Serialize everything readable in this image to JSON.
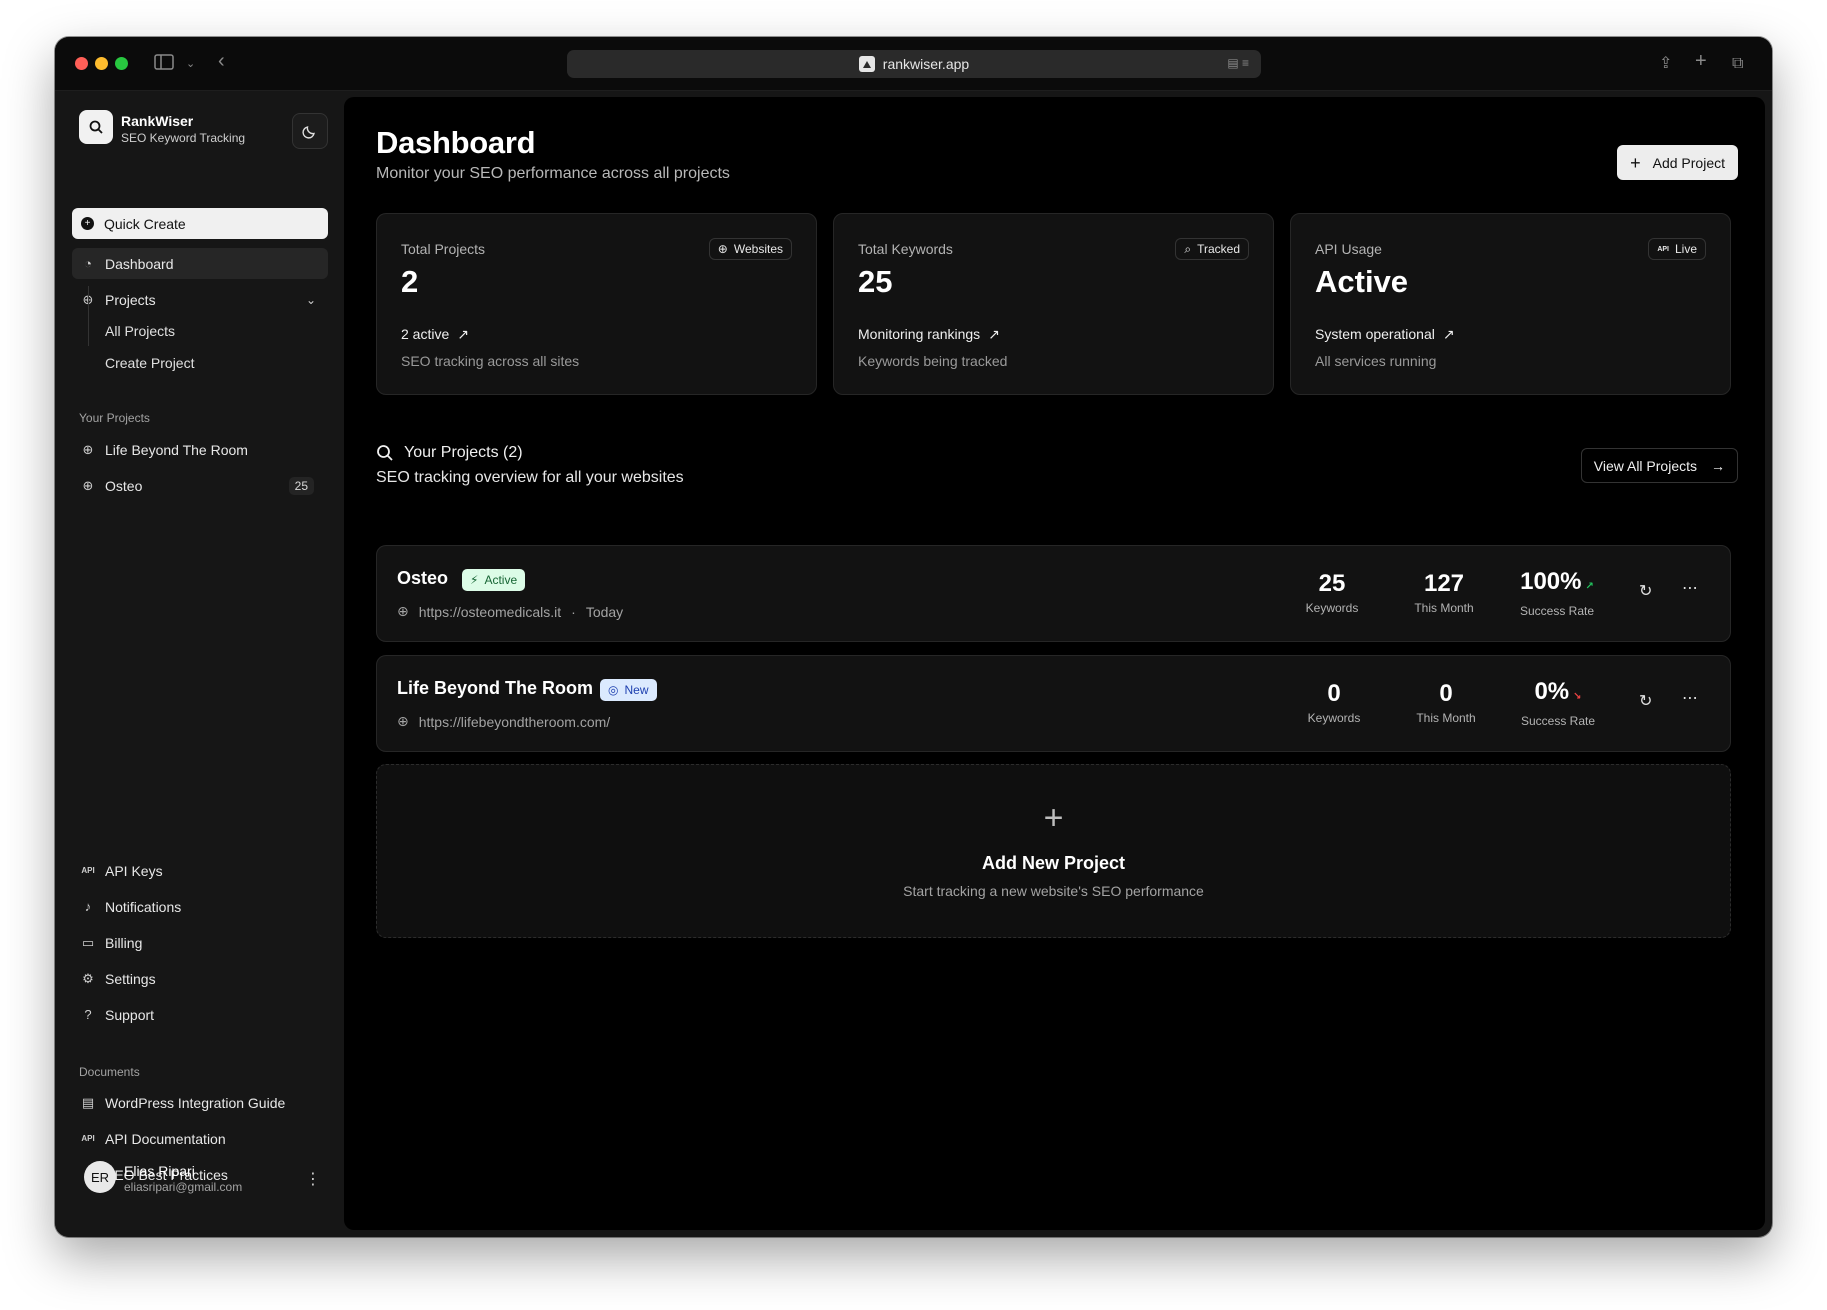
{
  "browser": {
    "url": "rankwiser.app"
  },
  "brand": {
    "name": "RankWiser",
    "tagline": "SEO Keyword Tracking"
  },
  "sidebar": {
    "quick_create": "Quick Create",
    "dashboard": "Dashboard",
    "projects": "Projects",
    "projects_sub": [
      "All Projects",
      "Create Project"
    ],
    "your_projects_label": "Your Projects",
    "your_projects": [
      {
        "name": "Life Beyond The Room",
        "count": ""
      },
      {
        "name": "Osteo",
        "count": "25"
      }
    ],
    "bottom_nav": [
      "API Keys",
      "Notifications",
      "Billing",
      "Settings",
      "Support"
    ],
    "documents_label": "Documents",
    "documents": [
      "WordPress Integration Guide",
      "API Documentation",
      "SEO Best Practices"
    ],
    "user": {
      "initials": "ER",
      "name": "Elias Ripari",
      "email": "eliasripari@gmail.com"
    }
  },
  "header": {
    "title": "Dashboard",
    "subtitle": "Monitor your SEO performance across all projects",
    "add_project": "Add Project"
  },
  "stats": [
    {
      "label": "Total Projects",
      "value": "2",
      "badge": "Websites",
      "trend": "2 active",
      "foot": "SEO tracking across all sites"
    },
    {
      "label": "Total Keywords",
      "value": "25",
      "badge": "Tracked",
      "trend": "Monitoring rankings",
      "foot": "Keywords being tracked"
    },
    {
      "label": "API Usage",
      "value": "Active",
      "badge": "Live",
      "trend": "System operational",
      "foot": "All services running"
    }
  ],
  "projects_section": {
    "title": "Your Projects (2)",
    "subtitle": "SEO tracking overview for all your websites",
    "view_all": "View All Projects"
  },
  "projects": [
    {
      "name": "Osteo",
      "status": "Active",
      "url": "https://osteomedicals.it",
      "date": "Today",
      "keywords": "25",
      "keywords_label": "Keywords",
      "month": "127",
      "month_label": "This Month",
      "success": "100%",
      "success_label": "Success Rate"
    },
    {
      "name": "Life Beyond The Room",
      "status": "New",
      "url": "https://lifebeyondtheroom.com/",
      "keywords": "0",
      "keywords_label": "Keywords",
      "month": "0",
      "month_label": "This Month",
      "success": "0%",
      "success_label": "Success Rate"
    }
  ],
  "add_new": {
    "title": "Add New Project",
    "subtitle": "Start tracking a new website's SEO performance"
  },
  "colors": {
    "background": "#000000",
    "sidebar": "#161616",
    "card": "#121212",
    "success": "#22c55e",
    "danger": "#ef4444"
  }
}
